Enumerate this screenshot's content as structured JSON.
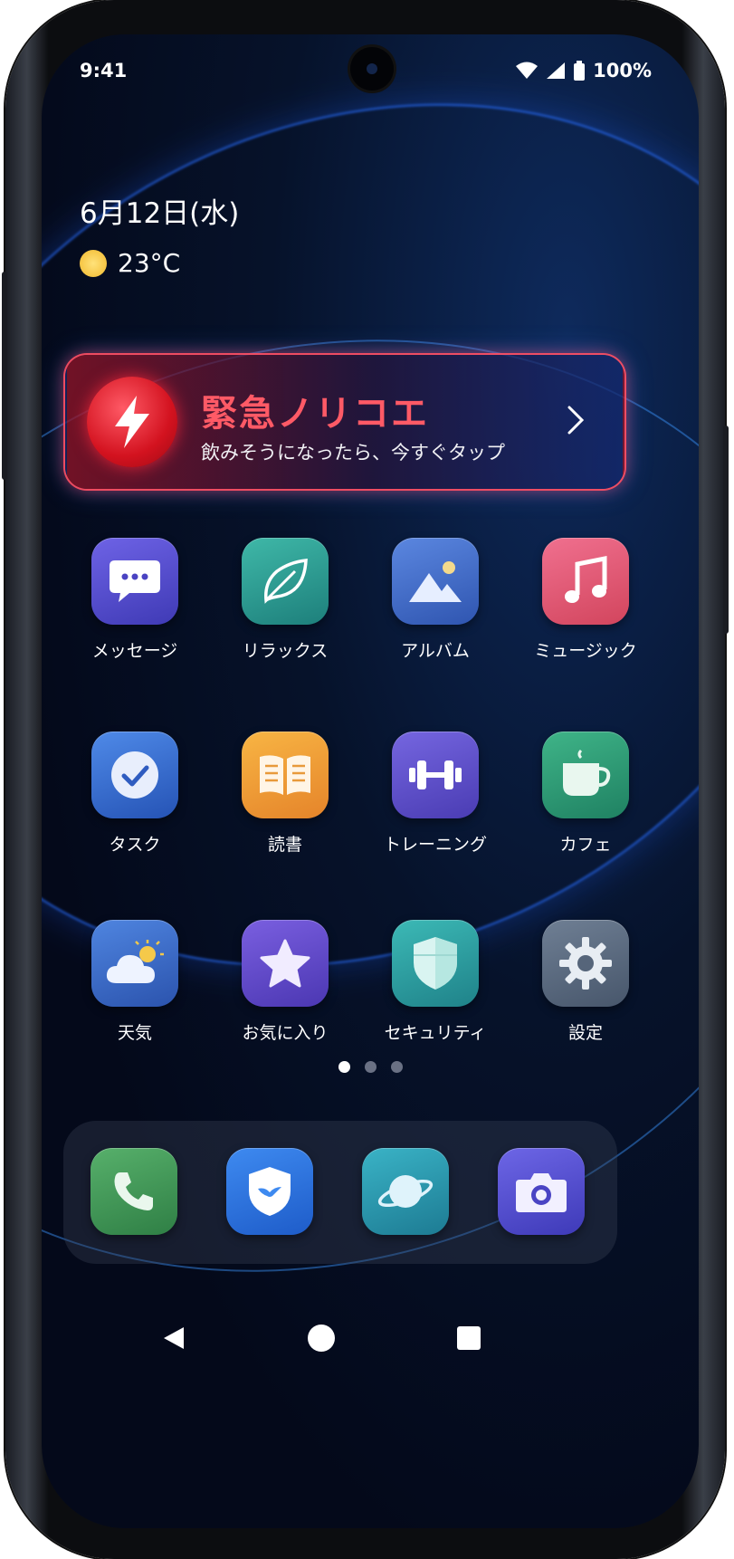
{
  "status_bar": {
    "time": "9:41",
    "battery": "100%",
    "icons": [
      "wifi-icon",
      "signal-icon",
      "battery-icon"
    ]
  },
  "widget": {
    "date": "6月12日(水)",
    "temperature": "23°C",
    "weather_icon": "sun-icon"
  },
  "banner": {
    "title": "緊急ノリコエ",
    "subtitle": "飲みそうになったら、今すぐタップ",
    "icon": "lightning-icon",
    "accent": "#ff3b4f"
  },
  "apps": [
    {
      "label": "メッセージ",
      "icon": "chat-bubble-icon"
    },
    {
      "label": "リラックス",
      "icon": "leaf-icon"
    },
    {
      "label": "アルバム",
      "icon": "mountain-photo-icon"
    },
    {
      "label": "ミュージック",
      "icon": "music-note-icon"
    },
    {
      "label": "タスク",
      "icon": "checkmark-icon"
    },
    {
      "label": "読書",
      "icon": "open-book-icon"
    },
    {
      "label": "トレーニング",
      "icon": "dumbbell-icon"
    },
    {
      "label": "カフェ",
      "icon": "coffee-cup-icon"
    },
    {
      "label": "天気",
      "icon": "cloud-sun-icon"
    },
    {
      "label": "お気に入り",
      "icon": "star-icon"
    },
    {
      "label": "セキュリティ",
      "icon": "shield-icon"
    },
    {
      "label": "設定",
      "icon": "gear-icon"
    }
  ],
  "page_indicator": {
    "pages": 3,
    "current": 1
  },
  "dock": [
    "phone-icon",
    "shield-bird-icon",
    "planet-icon",
    "camera-icon"
  ],
  "nav": [
    "back-icon",
    "home-icon",
    "recents-icon"
  ]
}
